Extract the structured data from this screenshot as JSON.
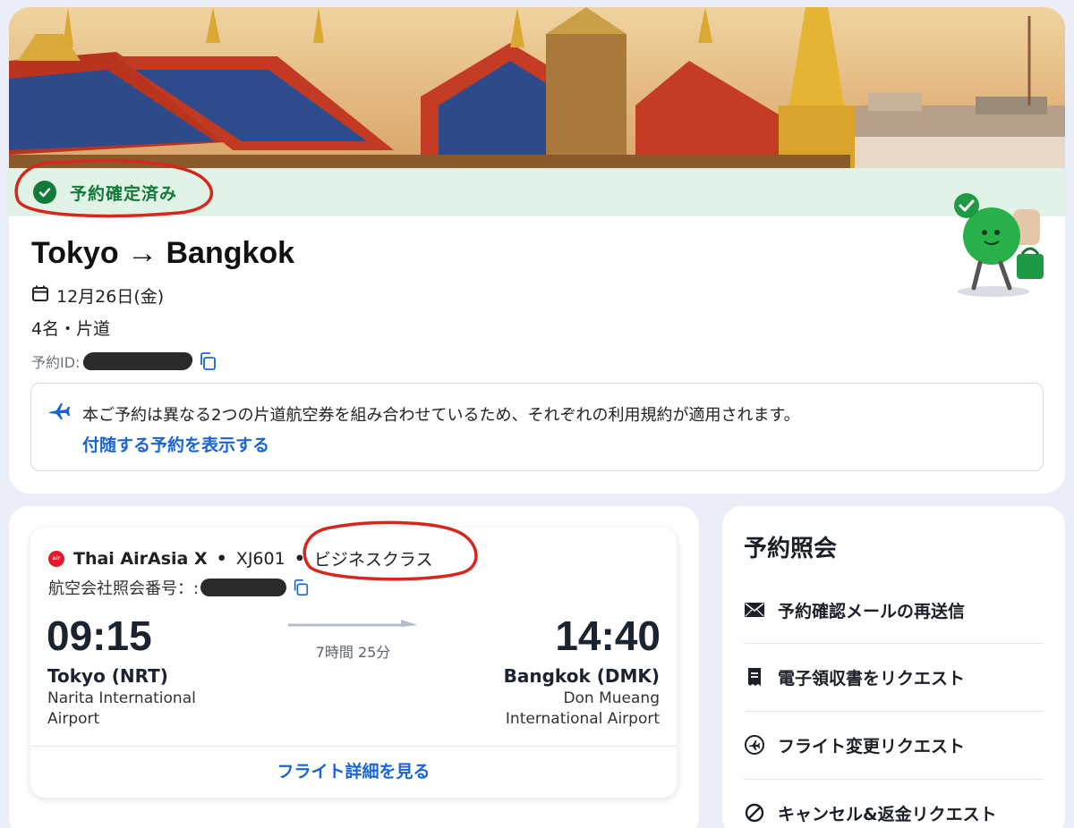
{
  "status": {
    "label": "予約確定済み"
  },
  "trip": {
    "route": "Tokyo → Bangkok",
    "date": "12月26日(金)",
    "passengers": "4名・片道",
    "booking_id_label": "予約ID:"
  },
  "notice": {
    "text": "本ご予約は異なる2つの片道航空券を組み合わせているため、それぞれの利用規約が適用されます。",
    "link": "付随する予約を表示する"
  },
  "flight": {
    "airline": "Thai AirAsia X",
    "flight_number": "XJ601",
    "cabin_class": "ビジネスクラス",
    "separator": "•",
    "pnr_label": "航空会社照会番号：:",
    "departure": {
      "time": "09:15",
      "city": "Tokyo (NRT)",
      "airport": "Narita International Airport"
    },
    "arrival": {
      "time": "14:40",
      "city": "Bangkok (DMK)",
      "airport": "Don Mueang International Airport"
    },
    "duration": "7時間 25分",
    "details_link": "フライト詳細を見る"
  },
  "side": {
    "title": "予約照会",
    "items": [
      {
        "label": "予約確認メールの再送信",
        "icon": "mail-icon"
      },
      {
        "label": "電子領収書をリクエスト",
        "icon": "receipt-icon"
      },
      {
        "label": "フライト変更リクエスト",
        "icon": "flight-change-icon"
      },
      {
        "label": "キャンセル&返金リクエスト",
        "icon": "cancel-icon"
      }
    ]
  },
  "colors": {
    "confirmed_green": "#137a3a",
    "link_blue": "#1a64d6",
    "annotation_red": "#d8261c"
  }
}
